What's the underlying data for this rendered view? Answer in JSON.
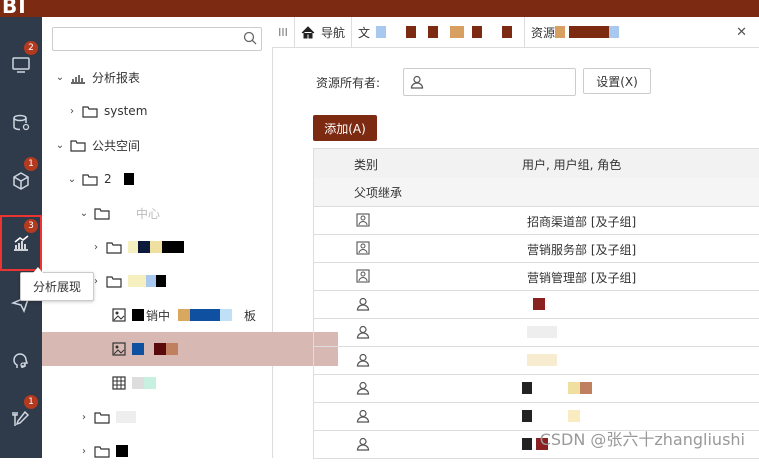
{
  "app": {
    "logo": "BI"
  },
  "leftnav": {
    "items": [
      {
        "name": "screen-icon",
        "badge": "2"
      },
      {
        "name": "database-icon",
        "badge": ""
      },
      {
        "name": "cube-icon",
        "badge": "1"
      },
      {
        "name": "chart-icon",
        "badge": "3"
      },
      {
        "name": "send-icon",
        "badge": ""
      },
      {
        "name": "brain-icon",
        "badge": ""
      },
      {
        "name": "tools-icon",
        "badge": "1"
      }
    ],
    "tooltip": "分析展现"
  },
  "tree": {
    "search_placeholder": "",
    "nodes": [
      {
        "label": "分析报表",
        "level": 0,
        "expanded": true
      },
      {
        "label": "system",
        "level": 1,
        "expanded": false
      },
      {
        "label": "公共空间",
        "level": 0,
        "expanded": true
      },
      {
        "label": "2",
        "level": 1,
        "expanded": true
      },
      {
        "label": "中心",
        "level": 2,
        "expanded": true
      },
      {
        "label": "",
        "level": 3,
        "expanded": false
      },
      {
        "label": "",
        "level": 3,
        "expanded": false
      },
      {
        "label": "销中",
        "suffix": "板",
        "level": 3
      },
      {
        "label": "",
        "level": 3
      },
      {
        "label": "",
        "level": 3
      },
      {
        "label": "",
        "level": 2
      },
      {
        "label": "",
        "level": 2
      }
    ]
  },
  "tabs": {
    "grip": "III",
    "home": "导航",
    "tab2": "文",
    "tab3": "资源"
  },
  "form": {
    "owner_label": "资源所有者:",
    "owner_value": "",
    "settings_button": "设置(X)",
    "add_button": "添加(A)"
  },
  "table": {
    "columns": [
      "类别",
      "用户, 用户组, 角色"
    ],
    "group": "父项继承",
    "rows": [
      {
        "type": "group",
        "value": "招商渠道部 [及子组]"
      },
      {
        "type": "group",
        "value": "营销服务部 [及子组]"
      },
      {
        "type": "group",
        "value": "营销管理部 [及子组]"
      },
      {
        "type": "user",
        "value": ""
      },
      {
        "type": "user",
        "value": ""
      },
      {
        "type": "user",
        "value": ""
      },
      {
        "type": "user",
        "value": ""
      },
      {
        "type": "user",
        "value": ""
      },
      {
        "type": "user",
        "value": ""
      }
    ]
  },
  "watermark": "CSDN @张六十zhangliushi",
  "colors": {
    "brand": "#7d2a12",
    "nav_bg": "#2f3a4a",
    "selection": "#d8b8b2"
  }
}
